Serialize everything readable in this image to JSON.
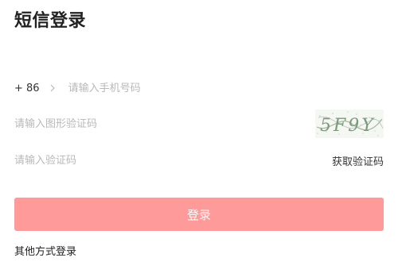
{
  "header": {
    "title": "短信登录"
  },
  "phone": {
    "country_code": "+ 86",
    "placeholder": "请输入手机号码",
    "value": ""
  },
  "image_code": {
    "placeholder": "请输入图形验证码",
    "value": "",
    "captcha_text": "5F9Y"
  },
  "sms_code": {
    "placeholder": "请输入验证码",
    "value": "",
    "get_code_label": "获取验证码"
  },
  "login": {
    "label": "登录"
  },
  "other_login": {
    "label": "其他方式登录"
  },
  "colors": {
    "login_button": "#ff9a9a",
    "title": "#222222",
    "placeholder": "#b8b8b8",
    "captcha_text": "#7c9a7c"
  },
  "icons": {
    "country_selector": "chevron-right-icon"
  }
}
